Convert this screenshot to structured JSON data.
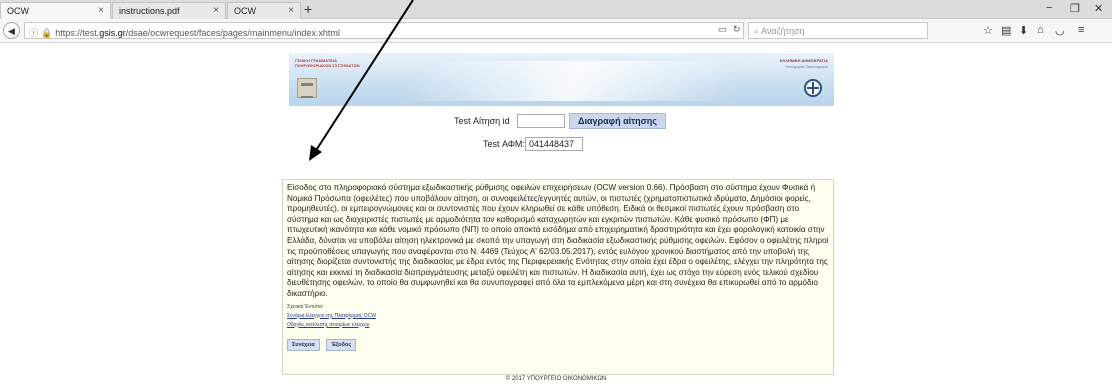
{
  "browser": {
    "tabs": [
      {
        "label": "OCW",
        "active": true
      },
      {
        "label": "instructions.pdf",
        "active": false
      },
      {
        "label": "OCW",
        "active": false
      }
    ],
    "new_tab": "+",
    "window_controls": {
      "minimize": "−",
      "restore": "❐",
      "close": "✕"
    },
    "url": {
      "prefix": "https://test.",
      "domain": "gsis.gr",
      "path": "/dsae/ocwrequest/faces/pages/mainmenu/index.xhtml"
    },
    "search_placeholder": "Αναζήτηση",
    "tab_close": "×"
  },
  "banner": {
    "gsis_line1": "ΓΕΝΙΚΗ ΓΡΑΜΜΑΤΕΙΑ",
    "gsis_line2": "ΠΛΗΡΟΦΟΡΙΑΚΩΝ ΣΥΣΤΗΜΑΤΩΝ",
    "gov_line1": "ΕΛΛΗΝΙΚΗ ΔΗΜΟΚΡΑΤΙΑ",
    "gov_line2": "Υπουργείο Οικονομικών"
  },
  "form": {
    "request_id_label": "Test Αίτηση id",
    "request_id_value": "",
    "delete_button": "Διαγραφή αίτησης",
    "afm_label": "Test ΑΦΜ:",
    "afm_value": "041448437"
  },
  "info": {
    "text": "Είσοδος στο πληροφοριακό σύστημα εξωδικαστικής ρύθμισης οφειλών επιχειρήσεων (OCW version 0.66). Πρόσβαση στο σύστημα έχουν Φυσικά ή Νομικά Πρόσωπα (οφειλέτες) που υποβάλουν αίτηση, οι συνοφειλέτες/εγγυητές αυτών, οι πιστωτές (χρηματοπιστωτικά ιδρύματα, Δημόσιοι φορείς, προμηθευτές), οι εμπειρογνώμονες και οι συντονιστές που έχουν κληρωθεί σε κάθε υπόθεση. Ειδικά οι θεσμικοί πιστωτές έχουν πρόσβαση στο σύστημα και ως διαχειριστές πιστωτές με αρμοδιότητα τον καθορισμό καταχωρητών και εγκριτών πιστωτών. Κάθε φυσικό πρόσωπο (ΦΠ) με πτωχευτική ικανότητα και κάθε νομικό πρόσωπο (ΝΠ) το οποίο αποκτά εισόδημα από επιχειρηματική δραστηριότητα και έχει φορολογική κατοικία στην Ελλάδα, δύναται να υποβάλει αίτηση ηλεκτρονικά με σκοπό την υπαγωγή στη διαδικασία εξωδικαστικής ρύθμισης οφειλών. Εφόσον ο οφειλέτης πληροί τις προϋποθέσεις υπαγωγής που αναφέρονται στο Ν. 4469 (Τεύχος Α' 62/03.05.2017), εντός ευλόγου χρονικού διαστήματος από την υποβολή της αίτησης διορίζεται συντονιστής της διαδικασίας με έδρα εντός της Περιφερειακής Ενότητας στην οποία έχει έδρα ο οφειλέτης, ελέγχει την πληρότητα της αίτησης και εκκινεί τη διαδικασία διαπραγμάτευσης μεταξύ οφειλέτη και πιστωτών. Η διαδικασία αυτή, έχει ως στόχο την εύρεση ενός τελικού σχεδίου διευθέτησης οφειλών, το οποίο θα συμφωνηθεί και θα συνυπογραφεί από όλα τα εμπλεκόμενα μέρη και στη συνέχεια θα επικυρωθεί από το αρμόδιο δικαστήριο.",
    "related_label": "Σχετικά Έντυπα:",
    "links": [
      "Σενάρια Ελέγχου της Πλατφόρμας OCW",
      "Οδηγίες εκτέλεσης σεναρίων ελέγχου"
    ],
    "continue_button": "Συνέχεια",
    "exit_button": "Έξοδος"
  },
  "footer": "© 2017 ΥΠΟΥΡΓΕΙΟ ΟΙΚΟΝΟΜΙΚΩΝ",
  "icons": {
    "back": "back-arrow-icon",
    "info": "info-icon",
    "lock": "lock-icon",
    "reader": "reader-view-icon",
    "reload": "reload-icon",
    "search": "search-icon",
    "bookmark": "bookmark-star-icon",
    "library": "library-icon",
    "download": "download-icon",
    "home": "home-icon",
    "pocket": "pocket-icon",
    "menu": "hamburger-menu-icon"
  }
}
